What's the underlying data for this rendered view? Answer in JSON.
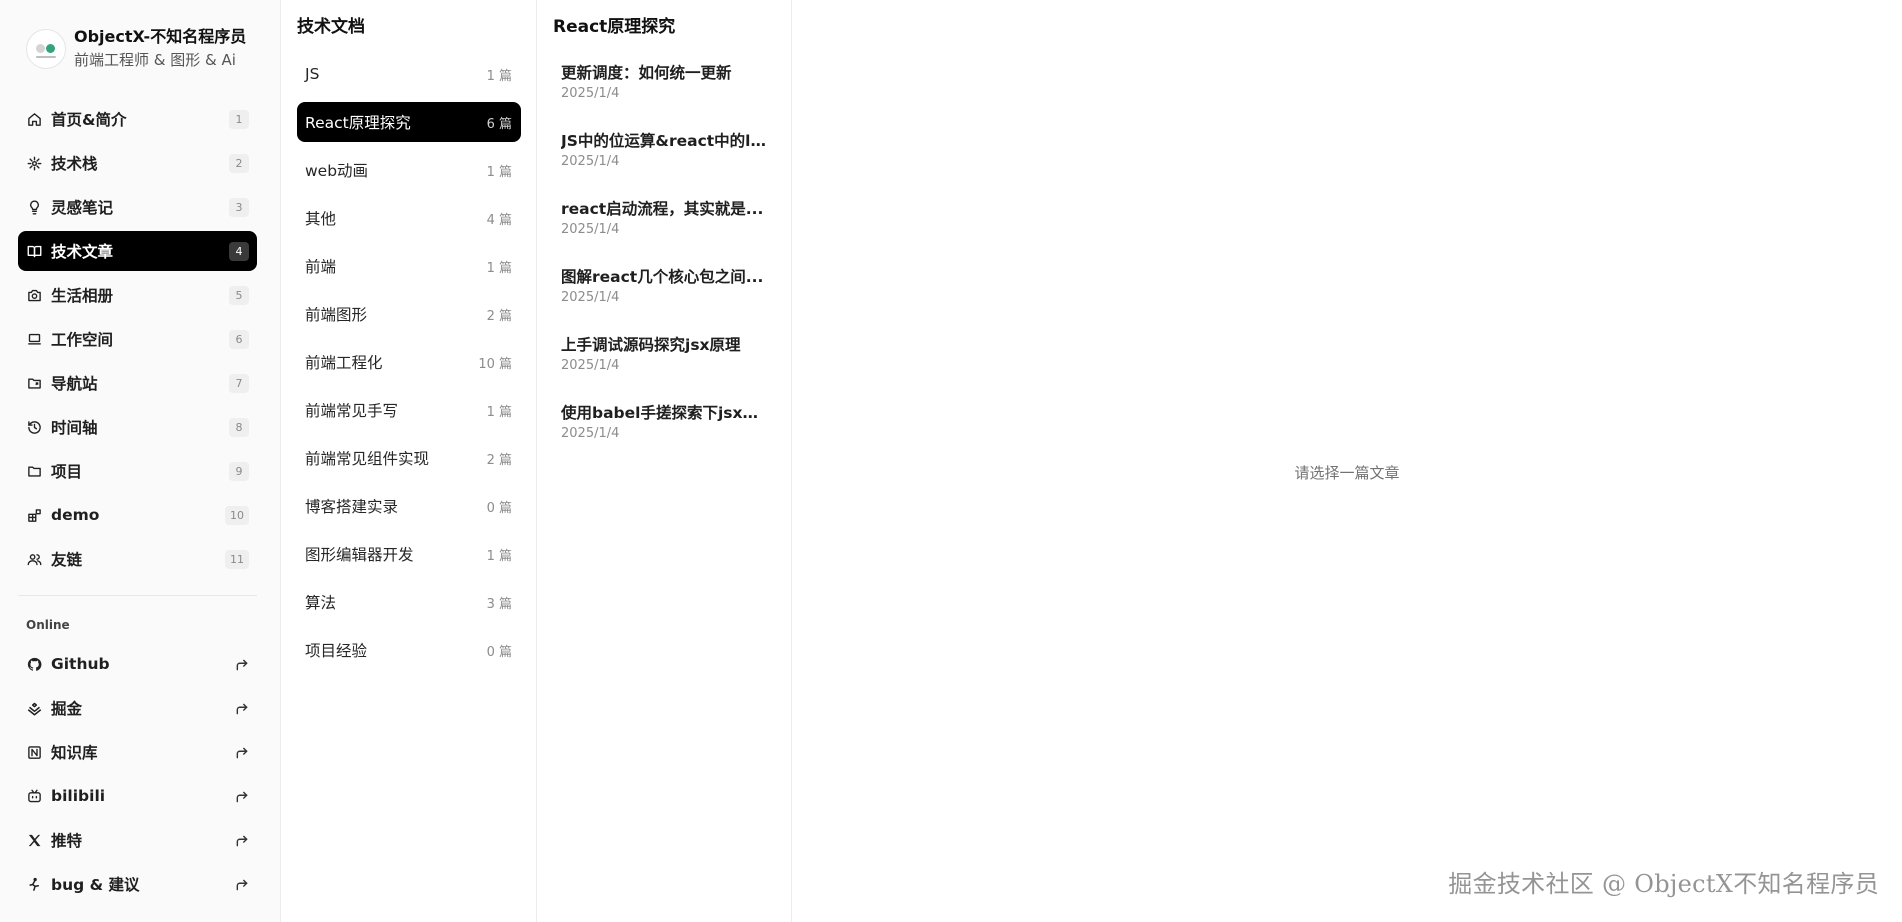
{
  "profile": {
    "name": "ObjectX-不知名程序员",
    "role": "前端工程师 & 图形 & Ai"
  },
  "nav": {
    "items": [
      {
        "label": "首页&简介",
        "key": "1",
        "icon": "home-icon"
      },
      {
        "label": "技术栈",
        "key": "2",
        "icon": "stack-icon"
      },
      {
        "label": "灵感笔记",
        "key": "3",
        "icon": "lightbulb-icon"
      },
      {
        "label": "技术文章",
        "key": "4",
        "icon": "book-icon",
        "active": true
      },
      {
        "label": "生活相册",
        "key": "5",
        "icon": "camera-icon"
      },
      {
        "label": "工作空间",
        "key": "6",
        "icon": "laptop-icon"
      },
      {
        "label": "导航站",
        "key": "7",
        "icon": "folder-link-icon"
      },
      {
        "label": "时间轴",
        "key": "8",
        "icon": "history-icon"
      },
      {
        "label": "项目",
        "key": "9",
        "icon": "folder-icon"
      },
      {
        "label": "demo",
        "key": "10",
        "icon": "blocks-icon"
      },
      {
        "label": "友链",
        "key": "11",
        "icon": "users-icon"
      }
    ]
  },
  "online": {
    "label": "Online",
    "items": [
      {
        "label": "Github",
        "icon": "github-icon"
      },
      {
        "label": "掘金",
        "icon": "juejin-icon"
      },
      {
        "label": "知识库",
        "icon": "notion-icon"
      },
      {
        "label": "bilibili",
        "icon": "bilibili-icon"
      },
      {
        "label": "推特",
        "icon": "x-twitter-icon"
      },
      {
        "label": "bug & 建议",
        "icon": "bug-icon"
      }
    ]
  },
  "categories": {
    "title": "技术文档",
    "items": [
      {
        "name": "JS",
        "count": "1 篇"
      },
      {
        "name": "React原理探究",
        "count": "6 篇",
        "active": true
      },
      {
        "name": "web动画",
        "count": "1 篇"
      },
      {
        "name": "其他",
        "count": "4 篇"
      },
      {
        "name": "前端",
        "count": "1 篇"
      },
      {
        "name": "前端图形",
        "count": "2 篇"
      },
      {
        "name": "前端工程化",
        "count": "10 篇"
      },
      {
        "name": "前端常见手写",
        "count": "1 篇"
      },
      {
        "name": "前端常见组件实现",
        "count": "2 篇"
      },
      {
        "name": "博客搭建实录",
        "count": "0 篇"
      },
      {
        "name": "图形编辑器开发",
        "count": "1 篇"
      },
      {
        "name": "算法",
        "count": "3 篇"
      },
      {
        "name": "项目经验",
        "count": "0 篇"
      }
    ]
  },
  "articles": {
    "title": "React原理探究",
    "items": [
      {
        "title": "更新调度：如何统一更新",
        "date": "2025/1/4"
      },
      {
        "title": "JS中的位运算&react中的l...",
        "date": "2025/1/4"
      },
      {
        "title": "react启动流程，其实就是...",
        "date": "2025/1/4"
      },
      {
        "title": "图解react几个核心包之间...",
        "date": "2025/1/4"
      },
      {
        "title": "上手调试源码探究jsx原理",
        "date": "2025/1/4"
      },
      {
        "title": "使用babel手搓探索下jsx的...",
        "date": "2025/1/4"
      }
    ]
  },
  "content": {
    "placeholder": "请选择一篇文章"
  },
  "watermark": "掘金技术社区 @ ObjectX不知名程序员",
  "colors": {
    "active_bg": "#000000",
    "sidebar_bg": "#fafafa",
    "avatar_accent": "#34a37a"
  }
}
